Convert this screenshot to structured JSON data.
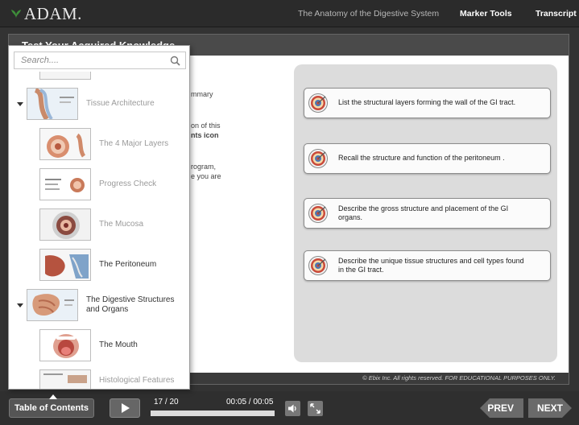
{
  "header": {
    "logo_text": "ADAM.",
    "course_title": "The Anatomy of the Digestive System",
    "marker_tools": "Marker Tools",
    "transcript": "Transcript"
  },
  "slide": {
    "title": "Test Your Acquired Knowledge",
    "body_fragments": [
      "mmary",
      "on of this",
      "nts  icon",
      "rogram,",
      "e you are"
    ],
    "objectives": [
      "List the structural layers forming the wall of the GI tract.",
      "Recall the structure and function of the peritoneum .",
      "Describe the gross structure and placement of the GI organs.",
      "Describe the unique tissue structures and cell types found in the GI tract."
    ],
    "copyright": "© Ebix Inc. All rights reserved. FOR EDUCATIONAL PURPOSES ONLY."
  },
  "toc": {
    "search_placeholder": "Search....",
    "items": [
      {
        "label": "Tissue Architecture",
        "level": 0
      },
      {
        "label": "The 4 Major Layers",
        "level": 1
      },
      {
        "label": "Progress Check",
        "level": 1
      },
      {
        "label": "The Mucosa",
        "level": 1
      },
      {
        "label": "The Peritoneum",
        "level": 1
      },
      {
        "label": "The Digestive Structures and Organs",
        "level": 0
      },
      {
        "label": "The Mouth",
        "level": 1
      },
      {
        "label": "Histological Features",
        "level": 1
      }
    ]
  },
  "controls": {
    "toc_button": "Table of Contents",
    "page_count": "17 / 20",
    "time": "00:05 / 00:05",
    "progress_fraction": 1.0,
    "prev": "PREV",
    "next": "NEXT"
  },
  "colors": {
    "accent_target": "#c0392b"
  }
}
